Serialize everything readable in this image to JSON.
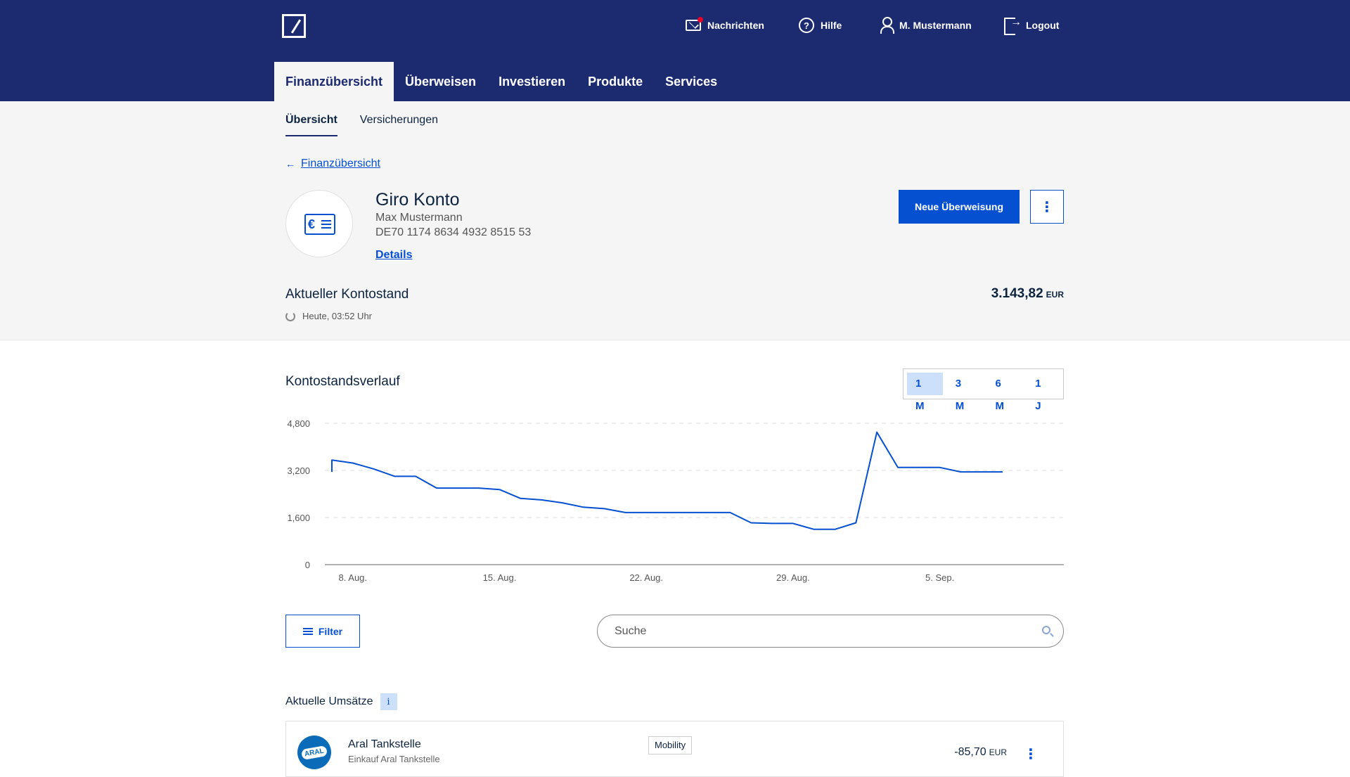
{
  "header": {
    "nav": [
      {
        "label": "Nachrichten",
        "icon": "mail-icon"
      },
      {
        "label": "Hilfe",
        "icon": "help-icon",
        "glyph": "?"
      },
      {
        "label": "M. Mustermann",
        "icon": "user-icon"
      },
      {
        "label": "Logout",
        "icon": "logout-icon"
      }
    ],
    "tabs": [
      "Finanzübersicht",
      "Überweisen",
      "Investieren",
      "Produkte",
      "Services"
    ]
  },
  "subnav": [
    "Übersicht",
    "Versicherungen"
  ],
  "back_link": "Finanzübersicht",
  "account": {
    "title": "Giro Konto",
    "owner": "Max Mustermann",
    "iban": "DE70 1174 8634 4932 8515 53",
    "details_label": "Details",
    "card_glyph": "€",
    "new_transfer_label": "Neue Überweisung",
    "more_glyph": "⋮"
  },
  "balance": {
    "label": "Aktueller Kontostand",
    "updated": "Heute, 03:52 Uhr",
    "value": "3.143,82",
    "currency": "EUR"
  },
  "history": {
    "title": "Kontostandsverlauf",
    "ranges": [
      "1 M",
      "3 M",
      "6 M",
      "1 J"
    ],
    "active_range": "1 M"
  },
  "chart_data": {
    "type": "line",
    "yticks": [
      "4,800",
      "3,200",
      "1,600",
      "0"
    ],
    "ytick_values": [
      4800,
      3200,
      1600,
      0
    ],
    "xticks": [
      "8. Aug.",
      "15. Aug.",
      "22. Aug.",
      "29. Aug.",
      "5. Sep."
    ],
    "ylim": [
      0,
      4800
    ],
    "x": [
      "2023-08-07",
      "2023-08-07",
      "2023-08-08",
      "2023-08-09",
      "2023-08-10",
      "2023-08-11",
      "2023-08-12",
      "2023-08-13",
      "2023-08-14",
      "2023-08-15",
      "2023-08-16",
      "2023-08-17",
      "2023-08-18",
      "2023-08-19",
      "2023-08-20",
      "2023-08-21",
      "2023-08-22",
      "2023-08-23",
      "2023-08-24",
      "2023-08-25",
      "2023-08-26",
      "2023-08-27",
      "2023-08-28",
      "2023-08-29",
      "2023-08-30",
      "2023-08-31",
      "2023-09-01",
      "2023-09-02",
      "2023-09-03",
      "2023-09-04",
      "2023-09-05",
      "2023-09-06",
      "2023-09-07",
      "2023-09-08"
    ],
    "values": [
      3150,
      3550,
      3450,
      3250,
      3000,
      3000,
      2600,
      2600,
      2600,
      2550,
      2250,
      2200,
      2100,
      1950,
      1900,
      1770,
      1770,
      1770,
      1770,
      1770,
      1770,
      1420,
      1400,
      1400,
      1200,
      1200,
      1420,
      4500,
      3300,
      3300,
      3300,
      3150,
      3150,
      3150
    ],
    "line_color": "#0550d1",
    "grid": "dashed horizontal"
  },
  "filter_label": "Filter",
  "search": {
    "placeholder": "Suche"
  },
  "transactions": {
    "title": "Aktuelle Umsätze",
    "info_glyph": "i",
    "items": [
      {
        "logo_text": "ARAL",
        "name": "Aral Tankstelle",
        "sub": "Einkauf Aral Tankstelle",
        "category": "Mobility",
        "amount": "-85,70",
        "currency": "EUR",
        "more_glyph": "⋮"
      }
    ]
  }
}
